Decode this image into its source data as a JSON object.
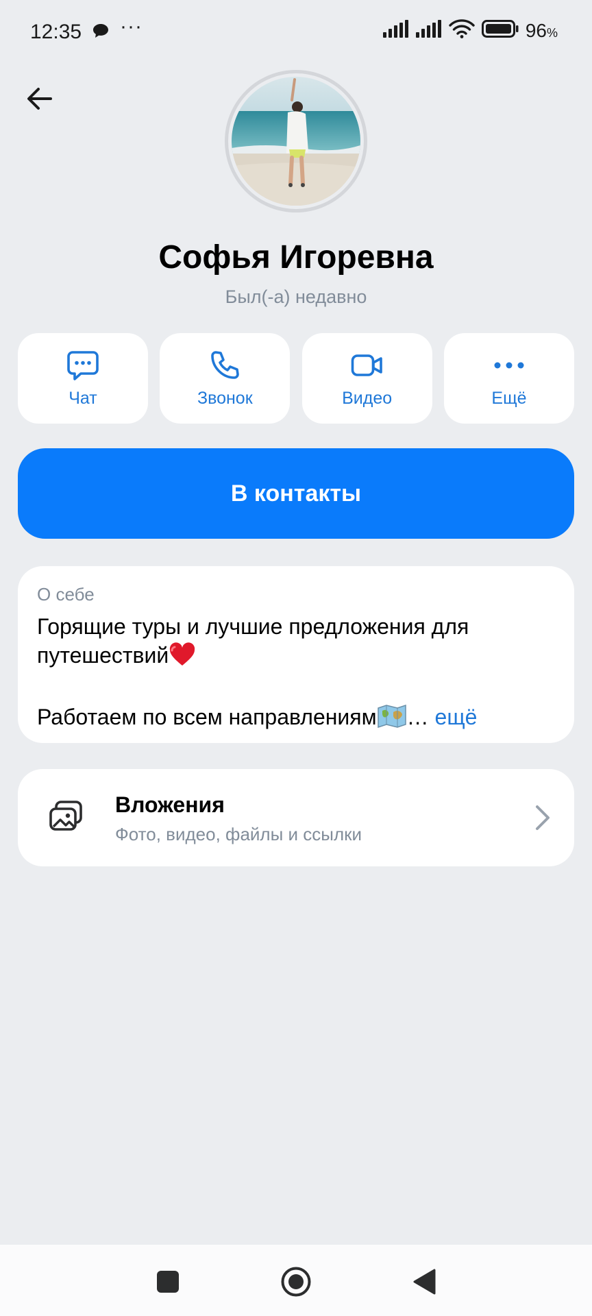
{
  "status_bar": {
    "time": "12:35",
    "more": "···",
    "battery": "96",
    "battery_unit": "%",
    "icons": [
      "chat-bubble-icon",
      "signal-icon",
      "signal-icon",
      "wifi-icon",
      "battery-icon"
    ]
  },
  "profile": {
    "name": "Софья Игоревна",
    "status": "Был(-а) недавно"
  },
  "actions": [
    {
      "label": "Чат",
      "icon": "chat-icon"
    },
    {
      "label": "Звонок",
      "icon": "phone-icon"
    },
    {
      "label": "Видео",
      "icon": "video-icon"
    },
    {
      "label": "Ещё",
      "icon": "more-icon"
    }
  ],
  "primary_button": {
    "label": "В контакты"
  },
  "about": {
    "heading": "О себе",
    "line1": "Горящие туры и лучшие предложения для",
    "line2": "путешествий",
    "line3": "Работаем по всем направлениям",
    "ellipsis": "…",
    "more": "ещё"
  },
  "attachments": {
    "title": "Вложения",
    "subtitle": "Фото, видео, файлы и ссылки"
  },
  "colors": {
    "accent": "#0a7bfb",
    "link": "#1f78d8",
    "background": "#ebedf0",
    "secondary_text": "#818c99"
  }
}
